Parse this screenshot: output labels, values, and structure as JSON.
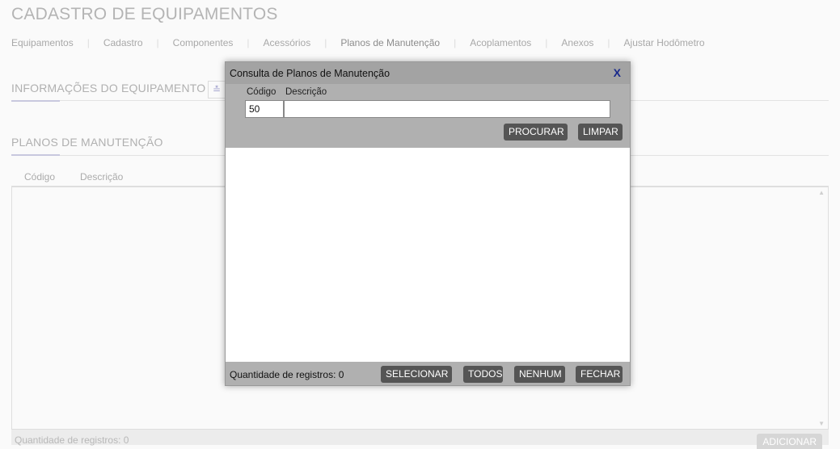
{
  "page": {
    "title": "CADASTRO DE EQUIPAMENTOS"
  },
  "tabs": [
    {
      "label": "Equipamentos"
    },
    {
      "label": "Cadastro"
    },
    {
      "label": "Componentes"
    },
    {
      "label": "Acessórios"
    },
    {
      "label": "Planos de Manutenção",
      "active": true
    },
    {
      "label": "Acoplamentos"
    },
    {
      "label": "Anexos"
    },
    {
      "label": "Ajustar Hodômetro"
    }
  ],
  "tab_separator": "|",
  "sections": {
    "equipment_info": {
      "title": "INFORMAÇÕES DO EQUIPAMENTO",
      "collapse_icon": "double-chevron-down-icon"
    },
    "maintenance_plans": {
      "title": "PLANOS DE MANUTENÇÃO"
    }
  },
  "grid": {
    "columns": [
      "Código",
      "Descrição"
    ],
    "record_count": "Quantidade de registros: 0",
    "add_label": "ADICIONAR"
  },
  "modal": {
    "title": "Consulta de Planos de Manutenção",
    "close_label": "X",
    "code_label": "Código",
    "desc_label": "Descrição",
    "code_value": "50",
    "desc_value": "",
    "search_label": "PROCURAR",
    "clear_label": "LIMPAR",
    "record_count": "Quantidade de registros: 0",
    "select_label": "SELECIONAR",
    "all_label": "TODOS",
    "none_label": "NENHUM",
    "close_button_label": "FECHAR"
  },
  "colors": {
    "modal_header": "#b0b0b0",
    "button": "#555555",
    "accent_underline": "#c8c8de",
    "close_x": "#1a2a8c"
  }
}
